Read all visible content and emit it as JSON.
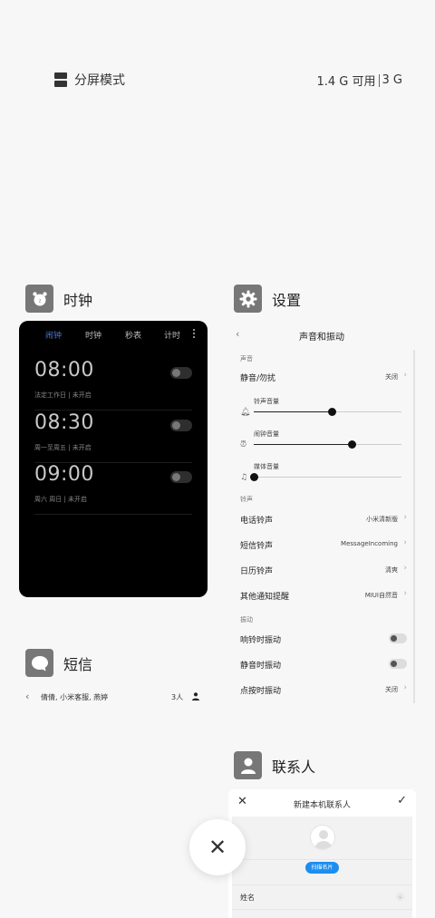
{
  "top_bar": {
    "split_mode_label": "分屏模式",
    "memory_available": "1.4 G 可用",
    "memory_total": "3 G"
  },
  "apps": {
    "clock": {
      "name": "时钟",
      "icon": "alarm-clock-icon",
      "tabs": [
        {
          "label": "闹钟",
          "active": true
        },
        {
          "label": "时钟",
          "active": false
        },
        {
          "label": "秒表",
          "active": false
        },
        {
          "label": "计时",
          "active": false
        }
      ],
      "alarms": [
        {
          "time": "08:00",
          "repeat": "法定工作日 | 未开启",
          "enabled": false
        },
        {
          "time": "08:30",
          "repeat": "周一至周五 | 未开启",
          "enabled": false
        },
        {
          "time": "09:00",
          "repeat": "周六 周日 | 未开启",
          "enabled": false
        }
      ]
    },
    "settings": {
      "name": "设置",
      "icon": "gear-icon",
      "page_title": "声音和振动",
      "section_sound": "声音",
      "silent": {
        "label": "静音/勿扰",
        "value": "关闭"
      },
      "volumes": [
        {
          "label": "铃声音量",
          "level": 0.53,
          "icon": "bell-icon"
        },
        {
          "label": "闹钟音量",
          "level": 0.66,
          "icon": "alarm-icon"
        },
        {
          "label": "媒体音量",
          "level": 0.0,
          "icon": "music-note-icon"
        }
      ],
      "section_ringtone": "铃声",
      "ringtones": [
        {
          "label": "电话铃声",
          "value": "小米清新版"
        },
        {
          "label": "短信铃声",
          "value": "MessageIncoming"
        },
        {
          "label": "日历铃声",
          "value": "清爽"
        },
        {
          "label": "其他通知提醒",
          "value": "MIUI自然音"
        }
      ],
      "section_vibration": "振动",
      "vibrations": [
        {
          "label": "响铃时振动",
          "type": "toggle"
        },
        {
          "label": "静音时振动",
          "type": "toggle"
        },
        {
          "label": "点按时振动",
          "value": "关闭"
        }
      ]
    },
    "sms": {
      "name": "短信",
      "icon": "chat-bubble-icon",
      "thread_names": "倩倩, 小米客服, 燕婷",
      "member_count": "3人"
    },
    "contacts": {
      "name": "联系人",
      "icon": "contact-person-icon",
      "page_title": "新建本机联系人",
      "scan_card_label": "扫描名片",
      "name_field_label": "姓名"
    }
  },
  "colors": {
    "background": "#f7f7f7",
    "clock_accent": "#4a78d8",
    "scan_button": "#1c8ef0"
  }
}
